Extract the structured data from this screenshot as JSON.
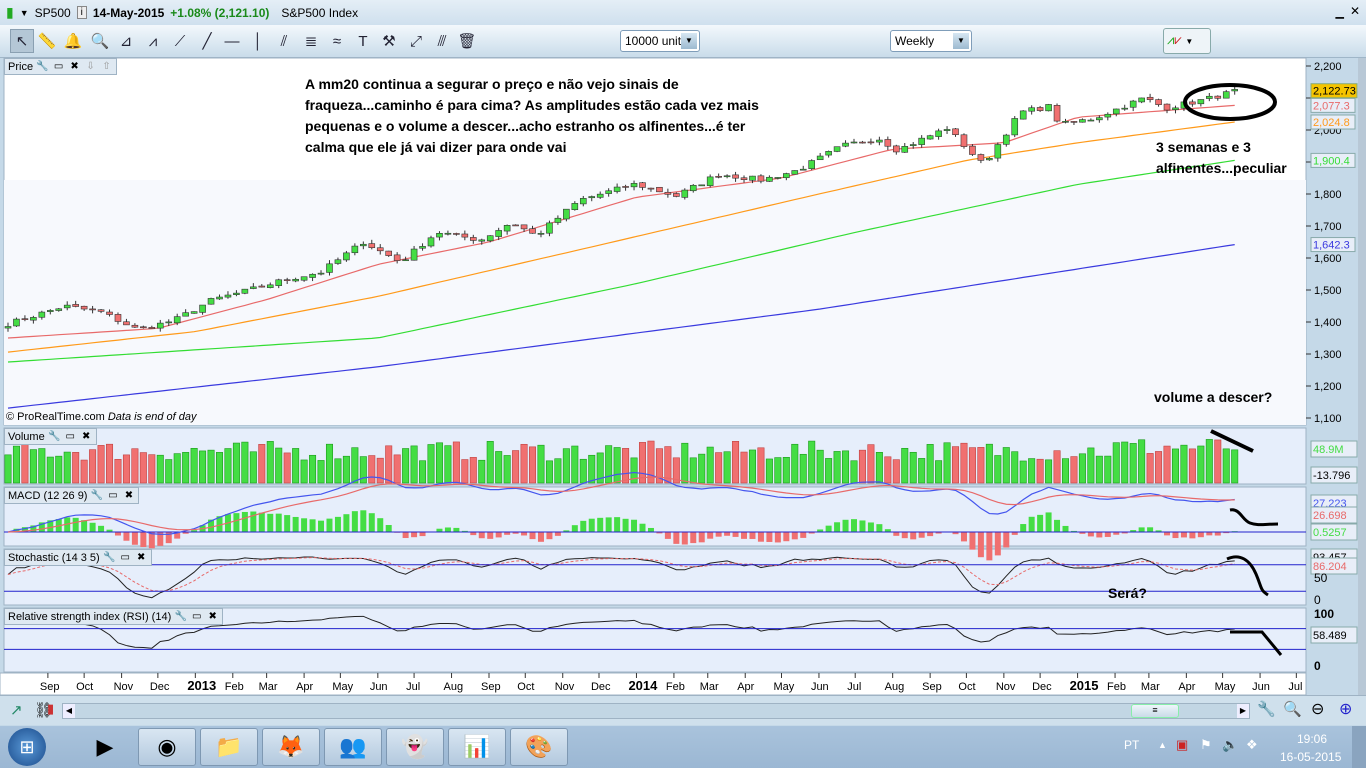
{
  "window": {
    "symbol": "SP500",
    "date": "14-May-2015",
    "change": "+1.08% (2,121.10)",
    "name": "S&P500 Index"
  },
  "toolbar": {
    "units": "10000 units",
    "period": "Weekly",
    "tools": [
      "pointer-icon",
      "ruler-icon",
      "alarm-bell-icon",
      "zoom-magnifier-icon",
      "triangle-pattern-icon",
      "channel-pattern-icon",
      "segment-icon",
      "line-icon",
      "horizontal-line-icon",
      "vertical-line-icon",
      "parallel-lines-icon",
      "fibonacci-icon",
      "trend-channel-icon",
      "text-icon",
      "tools-icon",
      "point-line-icon",
      "extended-line-icon",
      "trash-icon"
    ]
  },
  "price_panel": {
    "label": "Price",
    "credit": "© ProRealTime.com",
    "credit_note": "Data is end of day"
  },
  "annotations": {
    "main": [
      "A mm20 continua a segurar o preço e não vejo sinais de",
      "fraqueza...caminho é para cima? As amplitudes estão cada vez mais",
      "pequenas e o volume a descer...acho estranho os alfinentes...é ter",
      "calma que ele já vai dizer para onde vai"
    ],
    "pins": [
      "3 semanas e 3",
      "alfinentes...peculiar"
    ],
    "volume": "volume a descer?",
    "stoch": "Será?"
  },
  "panels": {
    "volume": "Volume",
    "macd": "MACD (12 26 9)",
    "stochastic": "Stochastic (14 3 5)",
    "rsi": "Relative strength index (RSI) (14)"
  },
  "chart_data": {
    "type": "candlestick",
    "interval": "weekly",
    "start_week": "2012-07-30",
    "weeks": 146,
    "close_anchors": [
      [
        "2012-07-30",
        1394
      ],
      [
        "2012-09-15",
        1450
      ],
      [
        "2012-10-15",
        1431
      ],
      [
        "2012-11-15",
        1375
      ],
      [
        "2012-12-15",
        1406
      ],
      [
        "2013-01-15",
        1469
      ],
      [
        "2013-02-15",
        1500
      ],
      [
        "2013-03-15",
        1531
      ],
      [
        "2013-04-15",
        1556
      ],
      [
        "2013-05-20",
        1650
      ],
      [
        "2013-06-20",
        1587
      ],
      [
        "2013-07-20",
        1681
      ],
      [
        "2013-08-25",
        1656
      ],
      [
        "2013-09-20",
        1712
      ],
      [
        "2013-10-10",
        1669
      ],
      [
        "2013-11-15",
        1781
      ],
      [
        "2013-12-31",
        1831
      ],
      [
        "2014-02-03",
        1794
      ],
      [
        "2014-03-10",
        1862
      ],
      [
        "2014-04-15",
        1844
      ],
      [
        "2014-05-15",
        1875
      ],
      [
        "2014-06-20",
        1950
      ],
      [
        "2014-07-20",
        1975
      ],
      [
        "2014-08-05",
        1937
      ],
      [
        "2014-09-15",
        2006
      ],
      [
        "2014-10-15",
        1891
      ],
      [
        "2014-11-15",
        2056
      ],
      [
        "2014-12-10",
        2075
      ],
      [
        "2014-12-17",
        2016
      ],
      [
        "2015-01-15",
        2037
      ],
      [
        "2015-02-25",
        2100
      ],
      [
        "2015-03-15",
        2069
      ],
      [
        "2015-04-15",
        2094
      ],
      [
        "2015-05-11",
        2121
      ]
    ],
    "moving_averages": [
      {
        "name": "MA20",
        "color": "#e86a6a",
        "last": "2,077.3",
        "points": [
          [
            "2012-07-30",
            1350
          ],
          [
            "2012-12-01",
            1380
          ],
          [
            "2013-03-01",
            1470
          ],
          [
            "2013-06-01",
            1580
          ],
          [
            "2013-09-01",
            1650
          ],
          [
            "2014-01-01",
            1790
          ],
          [
            "2014-05-01",
            1850
          ],
          [
            "2014-08-01",
            1940
          ],
          [
            "2014-11-01",
            1960
          ],
          [
            "2015-01-01",
            2040
          ],
          [
            "2015-05-11",
            2077
          ]
        ]
      },
      {
        "name": "MA50",
        "color": "#ff9a1a",
        "last": "2,024.8",
        "points": [
          [
            "2012-07-30",
            1306
          ],
          [
            "2013-01-01",
            1370
          ],
          [
            "2013-06-01",
            1480
          ],
          [
            "2013-12-01",
            1640
          ],
          [
            "2014-06-01",
            1800
          ],
          [
            "2014-10-01",
            1905
          ],
          [
            "2015-01-01",
            1960
          ],
          [
            "2015-05-11",
            2025
          ]
        ]
      },
      {
        "name": "MA100",
        "color": "#33dd33",
        "last": "1,900.4",
        "points": [
          [
            "2012-07-30",
            1275
          ],
          [
            "2013-06-01",
            1350
          ],
          [
            "2014-01-01",
            1520
          ],
          [
            "2014-07-01",
            1680
          ],
          [
            "2015-01-01",
            1830
          ],
          [
            "2015-05-11",
            1905
          ]
        ]
      },
      {
        "name": "MA300",
        "color": "#3a3adf",
        "last": "1,642.3",
        "points": [
          [
            "2012-07-30",
            1131
          ],
          [
            "2013-06-01",
            1260
          ],
          [
            "2014-06-01",
            1440
          ],
          [
            "2015-05-11",
            1642
          ]
        ]
      }
    ],
    "last_price": "2,122.73",
    "price_ticks": [
      2200,
      2100,
      2000,
      1900,
      1800,
      1700,
      1600,
      1500,
      1400,
      1300,
      1200,
      1100
    ],
    "price_tick_labels": [
      "2,200",
      "2,100",
      "2,000",
      "1,900",
      "1,800",
      "1,700",
      "1,600",
      "1,500",
      "1,400",
      "1,300",
      "1,200",
      "1,100"
    ],
    "ylim": [
      1100,
      2200
    ],
    "x_ticks": [
      [
        "2012-09-01",
        "Sep"
      ],
      [
        "2012-10-01",
        "Oct"
      ],
      [
        "2012-11-01",
        "Nov"
      ],
      [
        "2012-12-01",
        "Dec"
      ],
      [
        "2013-01-01",
        "2013"
      ],
      [
        "2013-02-01",
        "Feb"
      ],
      [
        "2013-03-01",
        "Mar"
      ],
      [
        "2013-04-01",
        "Apr"
      ],
      [
        "2013-05-01",
        "May"
      ],
      [
        "2013-06-01",
        "Jun"
      ],
      [
        "2013-07-01",
        "Jul"
      ],
      [
        "2013-08-01",
        "Aug"
      ],
      [
        "2013-09-01",
        "Sep"
      ],
      [
        "2013-10-01",
        "Oct"
      ],
      [
        "2013-11-01",
        "Nov"
      ],
      [
        "2013-12-01",
        "Dec"
      ],
      [
        "2014-01-01",
        "2014"
      ],
      [
        "2014-02-01",
        "Feb"
      ],
      [
        "2014-03-01",
        "Mar"
      ],
      [
        "2014-04-01",
        "Apr"
      ],
      [
        "2014-05-01",
        "May"
      ],
      [
        "2014-06-01",
        "Jun"
      ],
      [
        "2014-07-01",
        "Jul"
      ],
      [
        "2014-08-01",
        "Aug"
      ],
      [
        "2014-09-01",
        "Sep"
      ],
      [
        "2014-10-01",
        "Oct"
      ],
      [
        "2014-11-01",
        "Nov"
      ],
      [
        "2014-12-01",
        "Dec"
      ],
      [
        "2015-01-01",
        "2015"
      ],
      [
        "2015-02-01",
        "Feb"
      ],
      [
        "2015-03-01",
        "Mar"
      ],
      [
        "2015-04-01",
        "Apr"
      ],
      [
        "2015-05-01",
        "May"
      ],
      [
        "2015-06-01",
        "Jun"
      ],
      [
        "2015-07-01",
        "Jul"
      ]
    ],
    "volume_labels": {
      "last": "48.9M",
      "other": "-13.796"
    },
    "macd_labels": [
      "27.223",
      "26.698",
      "0.5257"
    ],
    "stoch_labels": {
      "k": "93.457",
      "d": "86.204",
      "ticks": [
        "50",
        "0"
      ]
    },
    "rsi_labels": {
      "value": "58.489",
      "ticks": [
        "100",
        "0"
      ]
    },
    "colors": {
      "up": "#44dd44",
      "down": "#f07070",
      "bg": "#ffffff",
      "panel_bg": "#eaf0fb"
    }
  },
  "taskbar": {
    "lang": "PT",
    "time": "19:06",
    "date": "16-05-2015",
    "apps": [
      "media-player-icon",
      "chrome-icon",
      "file-explorer-icon",
      "firefox-icon",
      "messenger-icon",
      "ghost-app-icon",
      "prorealtime-icon",
      "paint-icon"
    ]
  }
}
